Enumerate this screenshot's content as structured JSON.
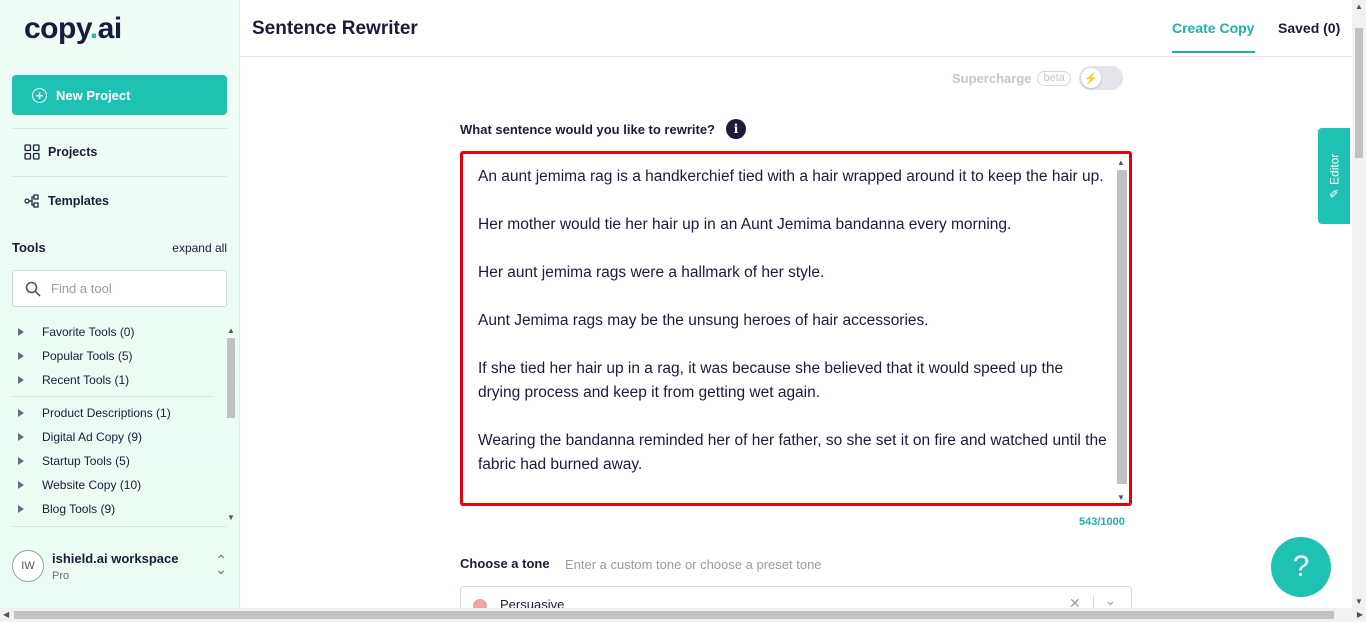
{
  "logo": {
    "text": "copy",
    "dot": ".",
    "suffix": "ai"
  },
  "sidebar": {
    "new_project": "New Project",
    "nav": [
      {
        "label": "Projects",
        "icon": "grid-icon"
      },
      {
        "label": "Templates",
        "icon": "templates-icon"
      }
    ],
    "tools_title": "Tools",
    "expand_all": "expand all",
    "search_placeholder": "Find a tool",
    "tool_groups_top": [
      "Favorite Tools (0)",
      "Popular Tools (5)",
      "Recent Tools (1)"
    ],
    "tool_groups": [
      "Product Descriptions (1)",
      "Digital Ad Copy (9)",
      "Startup Tools (5)",
      "Website Copy (10)",
      "Blog Tools (9)"
    ],
    "workspace": {
      "initials": "IW",
      "name": "ishield.ai workspace",
      "plan": "Pro"
    }
  },
  "header": {
    "title": "Sentence Rewriter",
    "tabs": {
      "create": "Create Copy",
      "saved": "Saved (0)"
    }
  },
  "main": {
    "supercharge": "Supercharge",
    "beta": "beta",
    "question": "What sentence would you like to rewrite?",
    "info": "i",
    "paragraphs": [
      "An aunt jemima rag is a handkerchief tied with a hair wrapped around it to keep the hair up.",
      "Her mother would tie her hair up in an Aunt Jemima bandanna every morning.",
      "Her aunt jemima rags were a hallmark of her style.",
      "Aunt Jemima rags may be the unsung heroes of hair accessories.",
      "If she tied her hair up in a rag, it was because she believed that it would speed up the drying process and keep it from getting wet again.",
      "Wearing the bandanna reminded her of her father, so she set it on fire and watched until the fabric had burned away."
    ],
    "counter": "543/1000",
    "tone_label": "Choose a tone",
    "tone_hint": "Enter a custom tone or choose a preset tone",
    "tone_value": "Persuasive"
  },
  "editor_tab": "Editor",
  "help": "?",
  "colors": {
    "accent": "#1fc2b2",
    "highlight": "#e8000d",
    "text": "#1c1b3a"
  }
}
